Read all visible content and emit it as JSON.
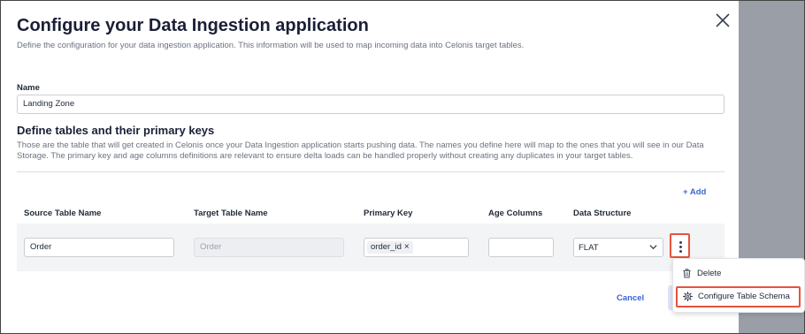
{
  "dialog": {
    "title": "Configure your Data Ingestion application",
    "subtitle": "Define the configuration for your data ingestion application. This information will be used to map incoming data into Celonis target tables."
  },
  "name_field": {
    "label": "Name",
    "value": "Landing Zone"
  },
  "tables_section": {
    "title": "Define tables and their primary keys",
    "description": "Those are the table that will get created in Celonis once your Data Ingestion application starts pushing data. The names you define here will map to the ones that you will see in our Data Storage. The primary key and age columns definitions are relevant to ensure delta loads can be handled properly without creating any duplicates in your target tables.",
    "add_label": "+ Add",
    "columns": [
      "Source Table Name",
      "Target Table Name",
      "Primary Key",
      "Age Columns",
      "Data Structure"
    ],
    "rows": [
      {
        "source_table": "Order",
        "target_table_placeholder": "Order",
        "primary_key_chip": "order_id",
        "age_columns": "",
        "data_structure": "FLAT"
      }
    ]
  },
  "row_menu": {
    "items": [
      {
        "label": "Delete",
        "icon": "trash-icon"
      },
      {
        "label": "Configure Table Schema",
        "icon": "gear-icon"
      }
    ]
  },
  "footer": {
    "cancel_label": "Cancel"
  },
  "colors": {
    "accent": "#3b63d8",
    "highlight": "#e5533d",
    "backdrop": "#9a9ea6"
  }
}
